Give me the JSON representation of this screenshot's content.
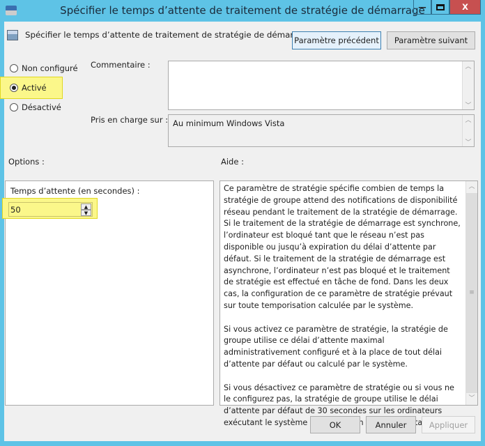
{
  "window": {
    "title": "Spécifier le temps d’attente de traitement de stratégie de démarrage",
    "minimize": "—",
    "maximize": "□",
    "close": "X",
    "close_color": "#c75050"
  },
  "header": {
    "title": "Spécifier le temps d’attente de traitement de stratégie de démarrage",
    "prev_button": "Paramètre précédent",
    "next_button": "Paramètre suivant"
  },
  "state": {
    "options": [
      {
        "label": "Non configuré",
        "checked": false
      },
      {
        "label": "Activé",
        "checked": true
      },
      {
        "label": "Désactivé",
        "checked": false
      }
    ]
  },
  "comment": {
    "label": "Commentaire :",
    "value": ""
  },
  "supported": {
    "label": "Pris en charge sur :",
    "value": "Au minimum Windows Vista"
  },
  "options": {
    "heading": "Options :",
    "timeout_label": "Temps d’attente (en secondes) :",
    "timeout_value": "50"
  },
  "help": {
    "heading": "Aide :",
    "paragraphs": [
      "Ce paramètre de stratégie spécifie combien de temps la stratégie de groupe attend des notifications de disponibilité réseau pendant le traitement de la stratégie de démarrage. Si le traitement de la stratégie de démarrage est synchrone, l’ordinateur est bloqué tant que le réseau n’est pas disponible ou jusqu’à expiration du délai d’attente par défaut. Si le traitement de la stratégie de démarrage est asynchrone, l’ordinateur n’est pas bloqué et le traitement de stratégie est effectué en tâche de fond. Dans les deux cas, la configuration de ce paramètre de stratégie prévaut sur toute temporisation calculée par le système.",
      "Si vous activez ce paramètre de stratégie, la stratégie de groupe utilise ce délai d’attente maximal administrativement configuré et à la place de tout délai d’attente par défaut ou calculé par le système.",
      "Si vous désactivez ce paramètre de stratégie ou si vous ne le configurez pas, la stratégie de groupe utilise le délai d’attente par défaut de 30 secondes sur les ordinateurs exécutant le système d’exploitation Windows Vista."
    ]
  },
  "footer": {
    "ok": "OK",
    "cancel": "Annuler",
    "apply": "Appliquer"
  }
}
